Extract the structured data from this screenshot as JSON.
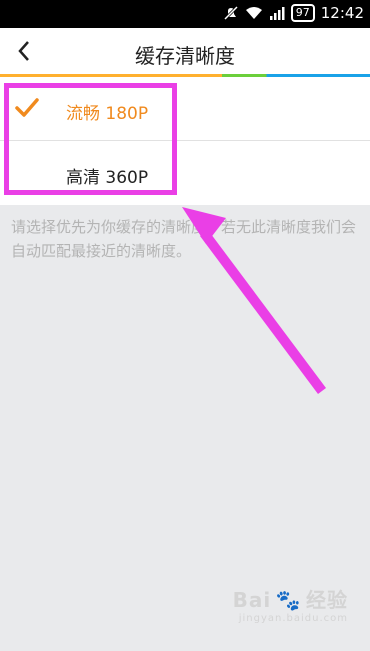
{
  "status_bar": {
    "time": "12:42",
    "battery_level": "97",
    "icons": [
      "mute-notification-icon",
      "wifi-icon",
      "signal-icon",
      "battery-icon"
    ]
  },
  "header": {
    "title": "缓存清晰度",
    "back_icon": "chevron-left-icon"
  },
  "options": [
    {
      "label": "流畅 180P",
      "selected": true
    },
    {
      "label": "高清 360P",
      "selected": false
    }
  ],
  "description": "请选择优先为你缓存的清晰度，若无此清晰度我们会自动匹配最接近的清晰度。",
  "watermark": {
    "brand": "Bai",
    "brand2": "经验",
    "url": "jingyan.baidu.com"
  },
  "colors": {
    "accent_orange": "#f08a1e",
    "highlight_magenta": "#ea3fe6",
    "background": "#e9eaec"
  }
}
